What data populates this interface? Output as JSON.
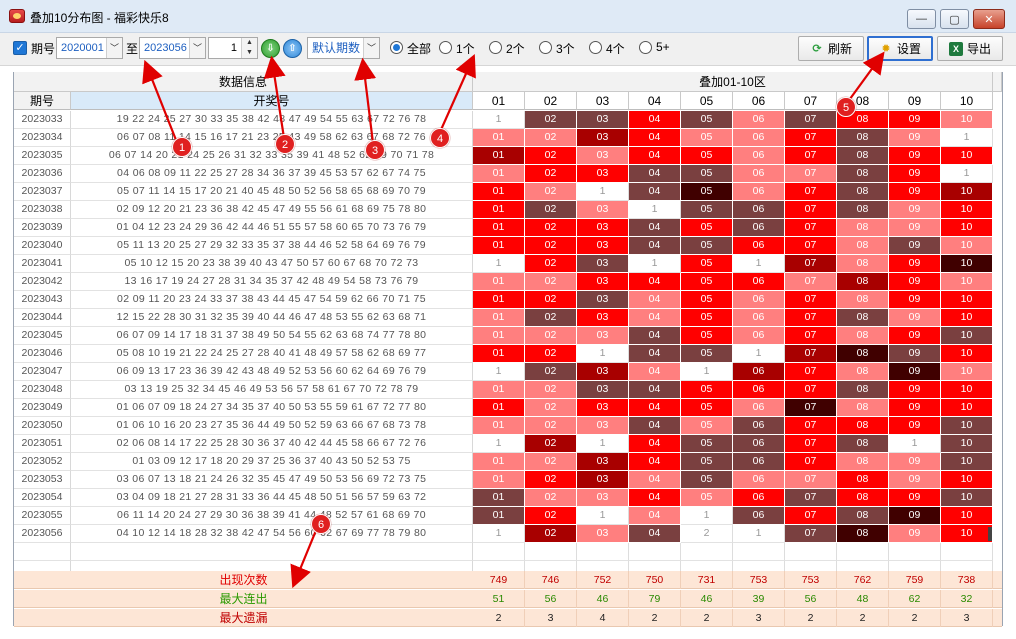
{
  "window": {
    "title": "叠加10分布图 - 福彩快乐8",
    "min_label": "—",
    "max_label": "▢",
    "close_label": "✕"
  },
  "toolbar": {
    "period_check": "✓",
    "period_label": "期号",
    "from_value": "2020001",
    "to_label": "至",
    "to_value": "2023056",
    "step_value": "1",
    "order_value": "默认期数",
    "radios": [
      "全部",
      "1个",
      "2个",
      "3个",
      "4个",
      "5+"
    ],
    "refresh_label": "刷新",
    "settings_label": "设置",
    "export_label": "导出"
  },
  "table": {
    "group_data_info": "数据信息",
    "group_overlay": "叠加01-10区",
    "col_period": "期号",
    "col_numbers": "开奖号",
    "zone_headers": [
      "01",
      "02",
      "03",
      "04",
      "05",
      "06",
      "07",
      "08",
      "09",
      "10"
    ],
    "rows": [
      {
        "period": "2023033",
        "numbers": "19 22 24 25 27 30 33 35 38 42 48 47 49 54 55 63 67 72 76 78",
        "cells": [
          "1",
          "02",
          "03",
          "04",
          "05",
          "06",
          "07",
          "08",
          "09",
          "10"
        ],
        "styles": [
          0,
          3,
          3,
          2,
          3,
          1,
          3,
          2,
          2,
          1
        ]
      },
      {
        "period": "2023034",
        "numbers": "06 07 08 11 14 15 16 17 21 23 25 43 49 58 62 63 67 68 72 76",
        "cells": [
          "01",
          "02",
          "03",
          "04",
          "05",
          "06",
          "07",
          "08",
          "09",
          "1"
        ],
        "styles": [
          1,
          1,
          4,
          2,
          1,
          1,
          2,
          3,
          1,
          0
        ]
      },
      {
        "period": "2023035",
        "numbers": "06 07 14 20 21 24 25 26 31 32 33 35 39 41 48 52 62 69 70 71 78",
        "cells": [
          "01",
          "02",
          "03",
          "04",
          "05",
          "06",
          "07",
          "08",
          "09",
          "10"
        ],
        "styles": [
          4,
          2,
          1,
          2,
          2,
          1,
          2,
          3,
          2,
          2
        ]
      },
      {
        "period": "2023036",
        "numbers": "04 06 08 09 11 22 25 27 28 34 36 37 39 45 53 57 62 67 74 75",
        "cells": [
          "01",
          "02",
          "03",
          "04",
          "05",
          "06",
          "07",
          "08",
          "09",
          "1"
        ],
        "styles": [
          1,
          2,
          2,
          3,
          3,
          1,
          1,
          3,
          2,
          0
        ]
      },
      {
        "period": "2023037",
        "numbers": "05 07 11 14 15 17 20 21 40 45 48 50 52 56 58 65 68 69 70 79",
        "cells": [
          "01",
          "02",
          "1",
          "04",
          "05",
          "06",
          "07",
          "08",
          "09",
          "10"
        ],
        "styles": [
          2,
          1,
          0,
          3,
          5,
          1,
          2,
          3,
          2,
          4
        ]
      },
      {
        "period": "2023038",
        "numbers": "02 09 12 20 21 23 36 38 42 45 47 49 55 56 61 68 69 75 78 80",
        "cells": [
          "01",
          "02",
          "03",
          "1",
          "05",
          "06",
          "07",
          "08",
          "09",
          "10"
        ],
        "styles": [
          2,
          3,
          1,
          0,
          3,
          3,
          2,
          3,
          1,
          2
        ]
      },
      {
        "period": "2023039",
        "numbers": "01 04 12 23 24 29 36 42 44 46 51 55 57 58 60 65 70 73 76 79",
        "cells": [
          "01",
          "02",
          "03",
          "04",
          "05",
          "06",
          "07",
          "08",
          "09",
          "10"
        ],
        "styles": [
          2,
          2,
          2,
          3,
          2,
          3,
          2,
          1,
          1,
          2
        ]
      },
      {
        "period": "2023040",
        "numbers": "05 11 13 20 25 27 29 32 33 35 37 38 44 46 52 58 64 69 76 79",
        "cells": [
          "01",
          "02",
          "03",
          "04",
          "05",
          "06",
          "07",
          "08",
          "09",
          "10"
        ],
        "styles": [
          2,
          2,
          2,
          3,
          3,
          2,
          2,
          1,
          3,
          1
        ]
      },
      {
        "period": "2023041",
        "numbers": "05 10 12 15 20 23 38 39 40 43 47 50 57 60 67 68 70 72 73",
        "cells": [
          "1",
          "02",
          "03",
          "1",
          "05",
          "1",
          "07",
          "08",
          "09",
          "10"
        ],
        "styles": [
          0,
          2,
          3,
          0,
          2,
          0,
          4,
          1,
          2,
          5
        ]
      },
      {
        "period": "2023042",
        "numbers": "13 16 17 19 24 27 28 31 34 35 37 42 48 49 54 58 73 76 79",
        "cells": [
          "01",
          "02",
          "03",
          "04",
          "05",
          "06",
          "07",
          "08",
          "09",
          "10"
        ],
        "styles": [
          1,
          1,
          2,
          2,
          2,
          2,
          1,
          4,
          2,
          1
        ]
      },
      {
        "period": "2023043",
        "numbers": "02 09 11 20 23 24 33 37 38 43 44 45 47 54 59 62 66 70 71 75",
        "cells": [
          "01",
          "02",
          "03",
          "04",
          "05",
          "06",
          "07",
          "08",
          "09",
          "10"
        ],
        "styles": [
          2,
          2,
          3,
          1,
          2,
          1,
          2,
          1,
          2,
          2
        ]
      },
      {
        "period": "2023044",
        "numbers": "12 15 22 28 30 31 32 35 39 40 44 46 47 48 53 55 62 63 68 71",
        "cells": [
          "01",
          "02",
          "03",
          "04",
          "05",
          "06",
          "07",
          "08",
          "09",
          "10"
        ],
        "styles": [
          1,
          3,
          2,
          1,
          2,
          1,
          2,
          3,
          1,
          2
        ]
      },
      {
        "period": "2023045",
        "numbers": "06 07 09 14 17 18 31 37 38 49 50 54 55 62 63 68 74 77 78 80",
        "cells": [
          "01",
          "02",
          "03",
          "04",
          "05",
          "06",
          "07",
          "08",
          "09",
          "10"
        ],
        "styles": [
          1,
          1,
          1,
          3,
          2,
          1,
          2,
          1,
          2,
          3
        ]
      },
      {
        "period": "2023046",
        "numbers": "05 08 10 19 21 22 24 25 27 28 40 41 48 49 57 58 62 68 69 77",
        "cells": [
          "01",
          "02",
          "1",
          "04",
          "05",
          "1",
          "07",
          "08",
          "09",
          "10"
        ],
        "styles": [
          2,
          2,
          0,
          3,
          3,
          0,
          4,
          5,
          3,
          2
        ]
      },
      {
        "period": "2023047",
        "numbers": "06 09 13 17 23 36 39 42 43 48 49 52 53 56 60 62 64 69 76 79",
        "cells": [
          "1",
          "02",
          "03",
          "04",
          "1",
          "06",
          "07",
          "08",
          "09",
          "10"
        ],
        "styles": [
          0,
          3,
          4,
          1,
          0,
          4,
          2,
          1,
          5,
          1
        ]
      },
      {
        "period": "2023048",
        "numbers": "03 13 19 25 32 34 45 46 49 53 56 57 58 61 67 70 72 78 79",
        "cells": [
          "01",
          "02",
          "03",
          "04",
          "05",
          "06",
          "07",
          "08",
          "09",
          "10"
        ],
        "styles": [
          1,
          1,
          3,
          3,
          2,
          2,
          2,
          3,
          2,
          2
        ]
      },
      {
        "period": "2023049",
        "numbers": "01 06 07 09 18 24 27 34 35 37 40 50 53 55 59 61 67 72 77 80",
        "cells": [
          "01",
          "02",
          "03",
          "04",
          "05",
          "06",
          "07",
          "08",
          "09",
          "10"
        ],
        "styles": [
          2,
          1,
          2,
          2,
          2,
          1,
          5,
          1,
          2,
          2
        ]
      },
      {
        "period": "2023050",
        "numbers": "01 06 10 16 20 23 27 35 36 44 49 50 52 59 63 66 67 68 73 78",
        "cells": [
          "01",
          "02",
          "03",
          "04",
          "05",
          "06",
          "07",
          "08",
          "09",
          "10"
        ],
        "styles": [
          1,
          1,
          1,
          3,
          1,
          3,
          2,
          2,
          2,
          3
        ]
      },
      {
        "period": "2023051",
        "numbers": "02 06 08 14 17 22 25 28 30 36 37 40 42 44 45 58 66 67 72 76",
        "cells": [
          "1",
          "02",
          "1",
          "04",
          "05",
          "06",
          "07",
          "08",
          "1",
          "10"
        ],
        "styles": [
          0,
          4,
          0,
          2,
          3,
          3,
          2,
          3,
          0,
          3
        ]
      },
      {
        "period": "2023052",
        "numbers": "01 03 09 12 17 18 20 29 37 25 36 37 40 43 50 52 53 75",
        "cells": [
          "01",
          "02",
          "03",
          "04",
          "05",
          "06",
          "07",
          "08",
          "09",
          "10"
        ],
        "styles": [
          1,
          1,
          4,
          2,
          3,
          3,
          2,
          1,
          1,
          3
        ]
      },
      {
        "period": "2023053",
        "numbers": "03 06 07 13 18 21 24 26 32 35 45 47 49 50 53 56 69 72 73 75",
        "cells": [
          "01",
          "02",
          "03",
          "04",
          "05",
          "06",
          "07",
          "08",
          "09",
          "10"
        ],
        "styles": [
          1,
          2,
          4,
          1,
          3,
          1,
          1,
          2,
          1,
          2
        ]
      },
      {
        "period": "2023054",
        "numbers": "03 04 09 18 21 27 28 31 33 36 44 45 48 50 51 56 57 59 63 72",
        "cells": [
          "01",
          "02",
          "03",
          "04",
          "05",
          "06",
          "07",
          "08",
          "09",
          "10"
        ],
        "styles": [
          3,
          1,
          1,
          2,
          1,
          2,
          3,
          2,
          2,
          3
        ]
      },
      {
        "period": "2023055",
        "numbers": "06 11 14 20 24 27 29 30 36 38 39 41 44 48 52 57 61 68 69 70",
        "cells": [
          "01",
          "02",
          "1",
          "04",
          "1",
          "06",
          "07",
          "08",
          "09",
          "10"
        ],
        "styles": [
          3,
          2,
          0,
          1,
          0,
          3,
          2,
          3,
          5,
          2
        ]
      },
      {
        "period": "2023056",
        "numbers": "04 10 12 14 18 28 32 38 42 47 54 56 60 62 67 69 77 78 79 80",
        "cells": [
          "1",
          "02",
          "03",
          "04",
          "2",
          "1",
          "07",
          "08",
          "09",
          "10"
        ],
        "styles": [
          0,
          4,
          1,
          3,
          0,
          0,
          3,
          5,
          1,
          2
        ]
      }
    ],
    "footer": [
      {
        "label": "出现次数",
        "values": [
          "749",
          "746",
          "752",
          "750",
          "731",
          "753",
          "753",
          "762",
          "759",
          "738"
        ]
      },
      {
        "label": "最大连出",
        "values": [
          "51",
          "56",
          "46",
          "79",
          "46",
          "39",
          "56",
          "48",
          "62",
          "32"
        ]
      },
      {
        "label": "最大遗漏",
        "values": [
          "2",
          "3",
          "4",
          "2",
          "2",
          "3",
          "2",
          "2",
          "2",
          "3"
        ]
      }
    ]
  },
  "annotations": [
    "1",
    "2",
    "3",
    "4",
    "5",
    "6"
  ],
  "colors": {
    "annotation_red": "#e02020",
    "arrow_red": "#e00000",
    "accent_blue": "#1f77d6",
    "header_blue": "#d9eaf9"
  }
}
